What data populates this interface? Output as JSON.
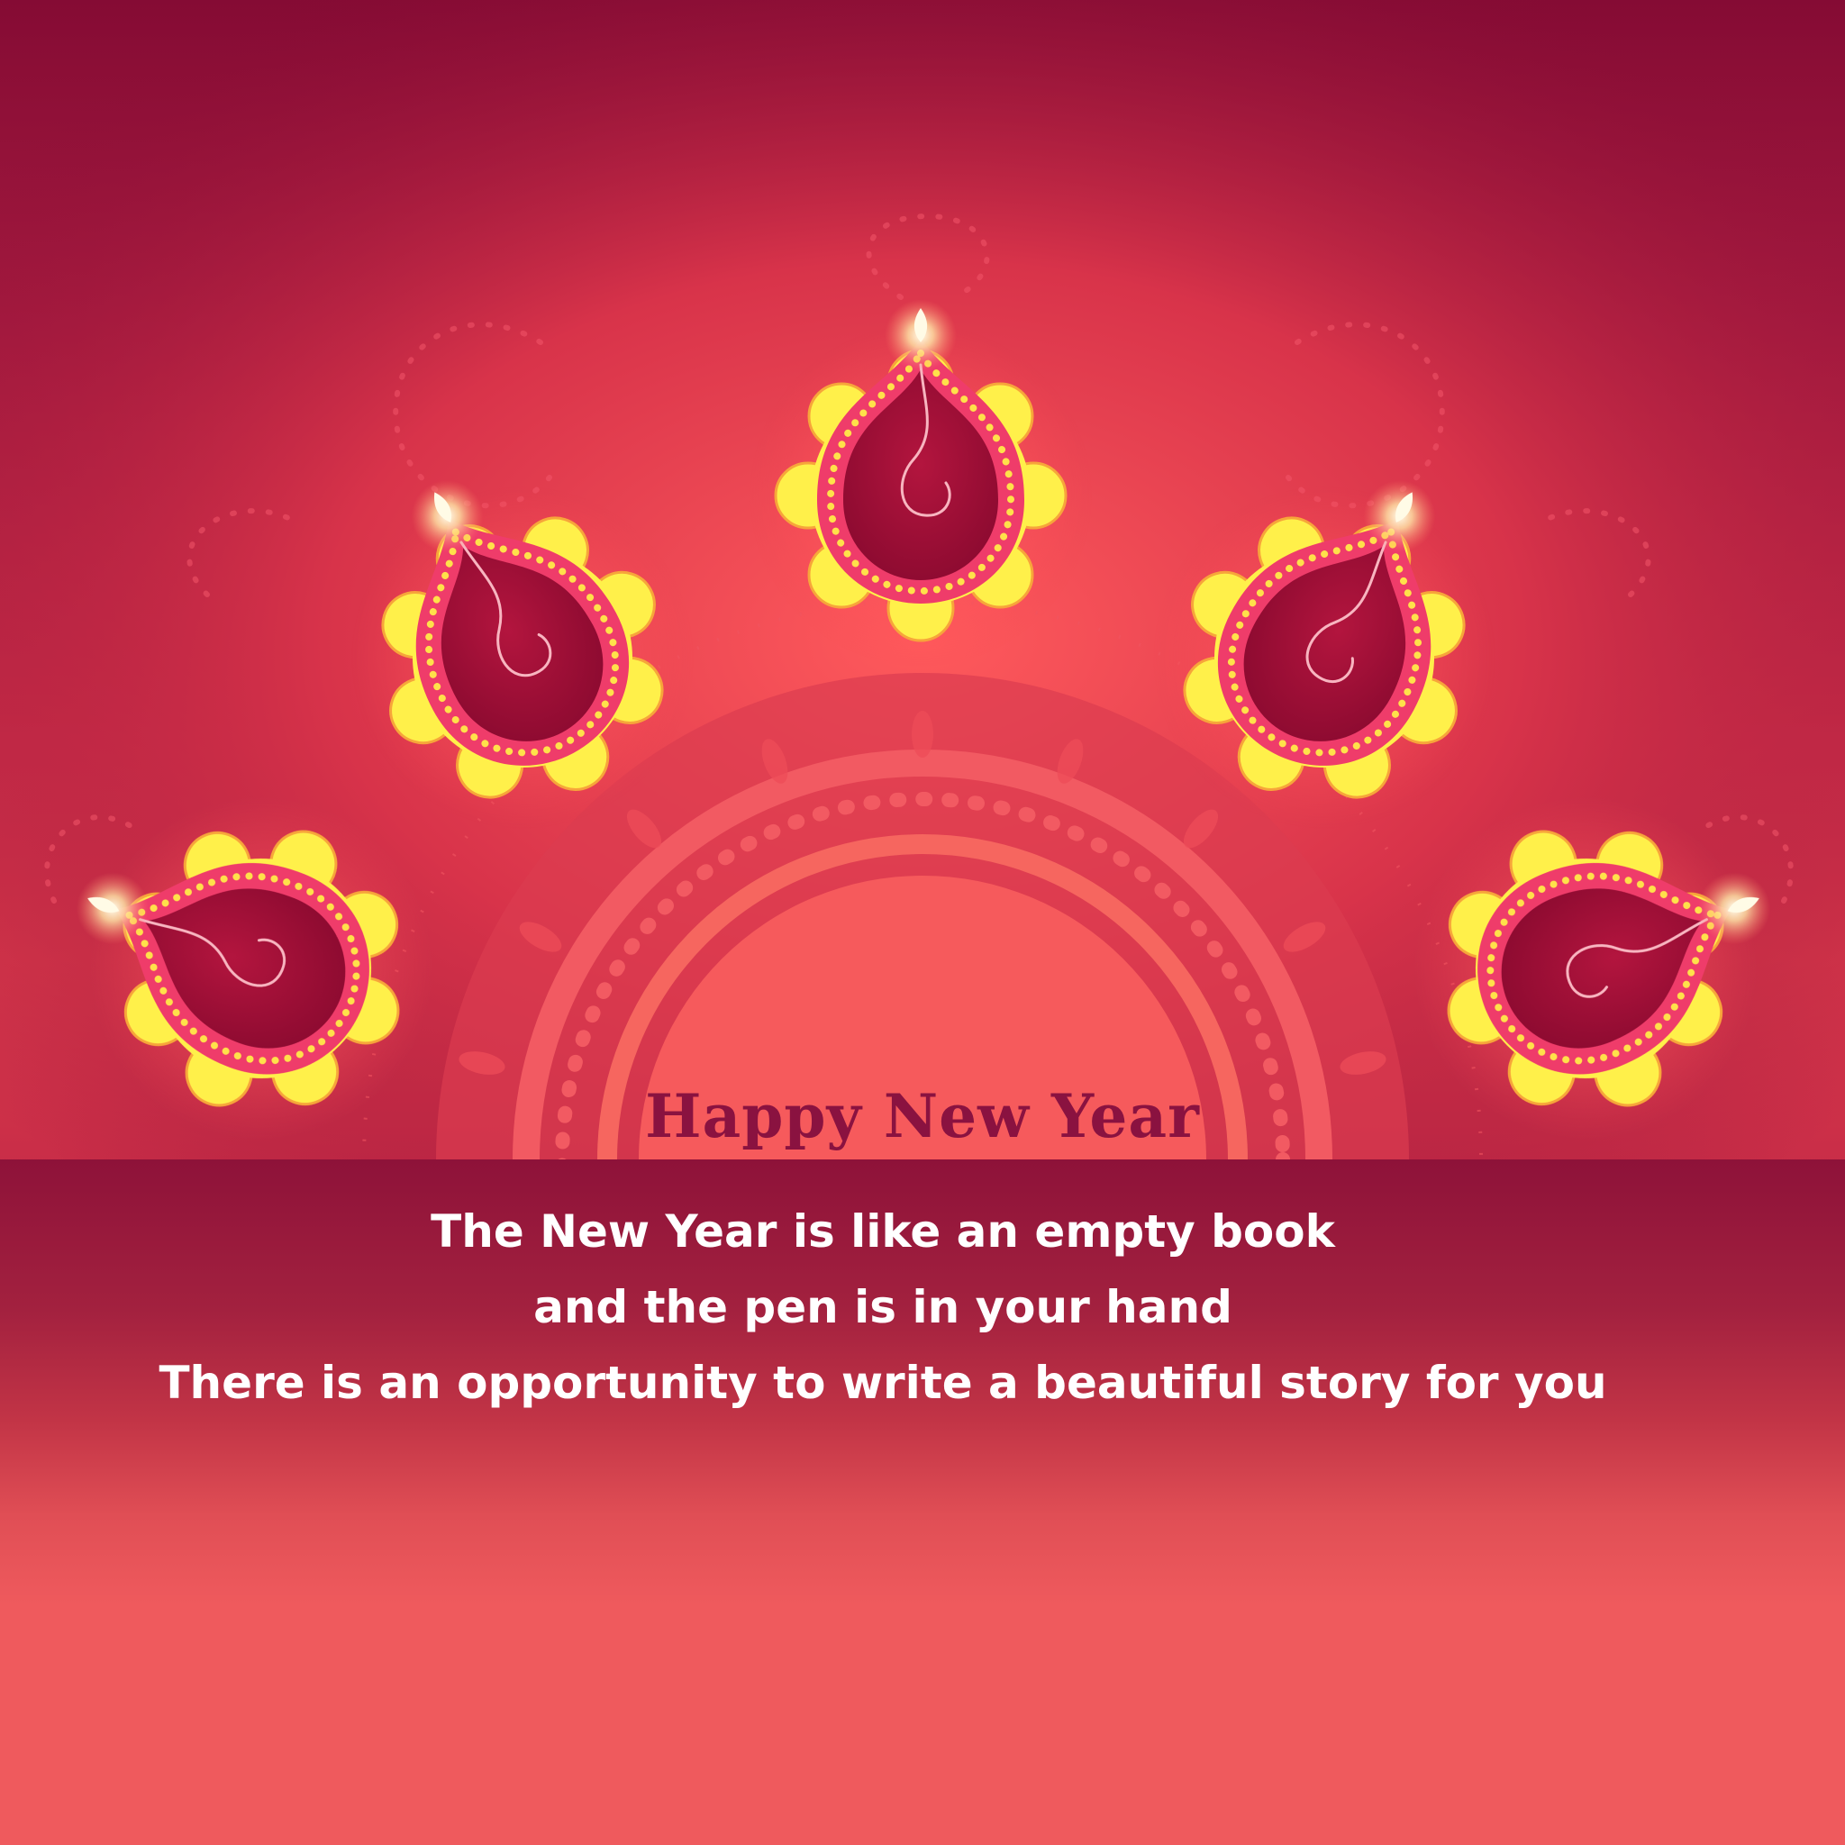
{
  "greeting": "Happy New Year",
  "quote": {
    "lines": [
      "The New Year is like an empty book",
      "and the pen is in your hand",
      "There is an opportunity to write a beautiful story for you"
    ]
  },
  "colors": {
    "background_top": "#850b34",
    "mandala_center": "#f65a5c",
    "lamp_body": "#a9113a",
    "lamp_dots": "#ffd84a",
    "petals": "#fff04a",
    "flame": "#fffbe6",
    "greeting_text": "#8a1240",
    "quote_text": "#ffffff"
  },
  "icons": [
    "diya-lamp-icon",
    "flame-icon",
    "mandala-pattern"
  ]
}
